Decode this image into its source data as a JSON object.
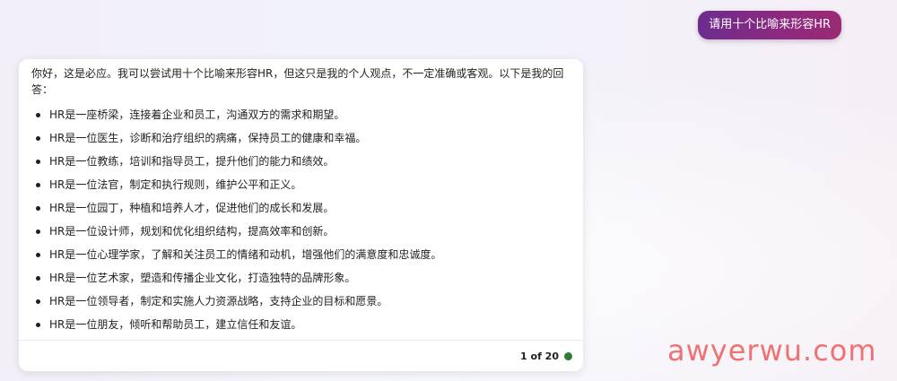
{
  "user": {
    "prompt": "请用十个比喻来形容HR"
  },
  "assistant": {
    "intro": "你好，这是必应。我可以尝试用十个比喻来形容HR，但这只是我的个人观点，不一定准确或客观。以下是我的回答：",
    "items": [
      "HR是一座桥梁，连接着企业和员工，沟通双方的需求和期望。",
      "HR是一位医生，诊断和治疗组织的病痛，保持员工的健康和幸福。",
      "HR是一位教练，培训和指导员工，提升他们的能力和绩效。",
      "HR是一位法官，制定和执行规则，维护公平和正义。",
      "HR是一位园丁，种植和培养人才，促进他们的成长和发展。",
      "HR是一位设计师，规划和优化组织结构，提高效率和创新。",
      "HR是一位心理学家，了解和关注员工的情绪和动机，增强他们的满意度和忠诚度。",
      "HR是一位艺术家，塑造和传播企业文化，打造独特的品牌形象。",
      "HR是一位领导者，制定和实施人力资源战略，支持企业的目标和愿景。",
      "HR是一位朋友，倾听和帮助员工，建立信任和友谊。"
    ],
    "counter": "1 of 20",
    "status_color": "#2e7d32"
  },
  "watermark": {
    "text": "awyerwu.com",
    "color": "#ec4d4d"
  },
  "colors": {
    "user_bubble_start": "#6d2c8f",
    "user_bubble_end": "#9b2a74",
    "card_bg": "#ffffff",
    "text": "#1f1f1f"
  }
}
